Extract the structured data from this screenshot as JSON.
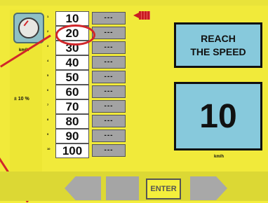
{
  "left_panel": {
    "unit": "km/h",
    "tolerance": "± 10 %"
  },
  "speed_list": [
    {
      "index": "1",
      "value": "10",
      "result": "---"
    },
    {
      "index": "2",
      "value": "20",
      "result": "---"
    },
    {
      "index": "3",
      "value": "30",
      "result": "---"
    },
    {
      "index": "4",
      "value": "40",
      "result": "---"
    },
    {
      "index": "5",
      "value": "50",
      "result": "---"
    },
    {
      "index": "6",
      "value": "60",
      "result": "---"
    },
    {
      "index": "7",
      "value": "70",
      "result": "---"
    },
    {
      "index": "8",
      "value": "80",
      "result": "---"
    },
    {
      "index": "9",
      "value": "90",
      "result": "---"
    },
    {
      "index": "10",
      "value": "100",
      "result": "---"
    }
  ],
  "target_panel": {
    "title": "REACH\nTHE SPEED",
    "speed": "10",
    "unit": "km/h"
  },
  "bottom_buttons": {
    "enter_label": "ENTER"
  },
  "colors": {
    "background": "#f1ea3a",
    "panel_blue": "#87c9dc",
    "highlight_red": "#d1262a",
    "button_gray": "#a8a8a8"
  },
  "icons": {
    "gauge": "speedometer-icon",
    "current_marker": "red-arrow-indicator-icon"
  }
}
